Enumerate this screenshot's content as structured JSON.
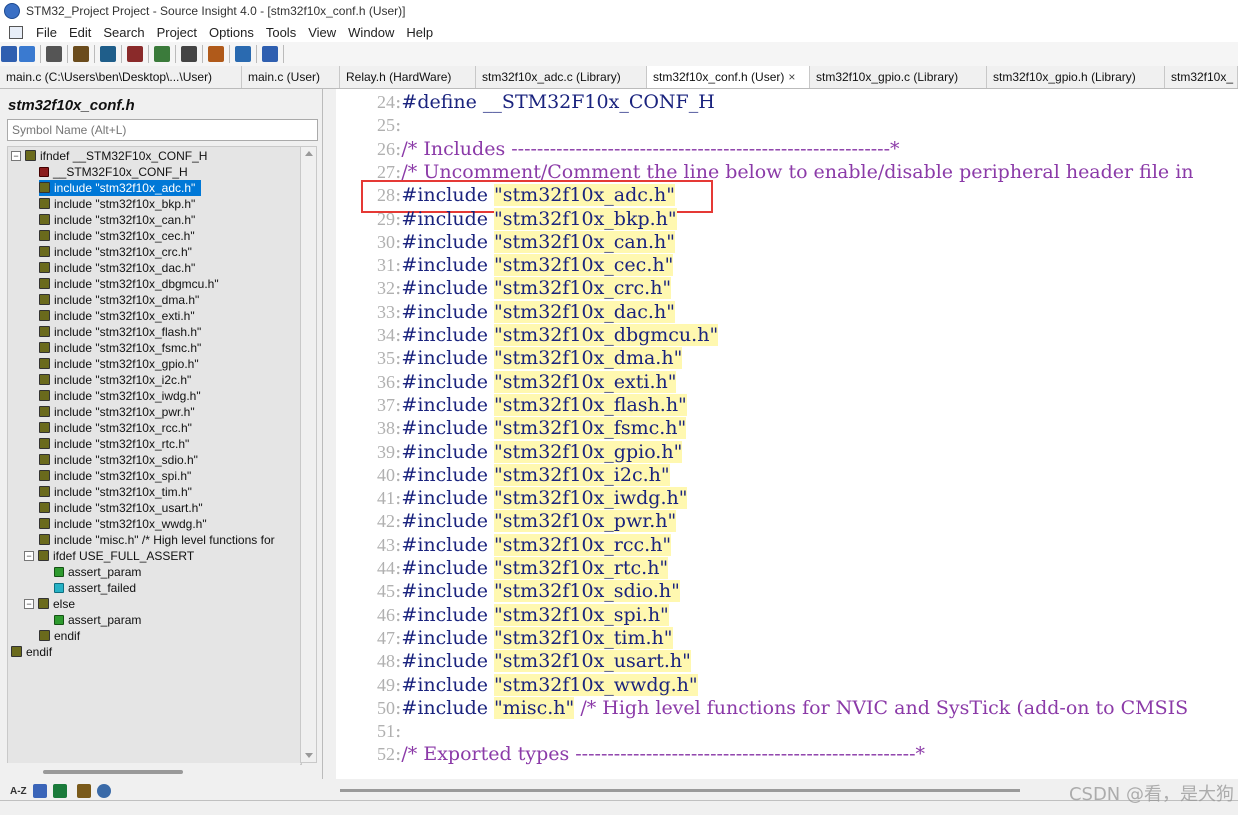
{
  "window": {
    "title": "STM32_Project Project - Source Insight 4.0 - [stm32f10x_conf.h (User)]"
  },
  "menu": [
    "File",
    "Edit",
    "Search",
    "Project",
    "Options",
    "Tools",
    "View",
    "Window",
    "Help"
  ],
  "tabs": [
    {
      "label": "main.c (C:\\Users\\ben\\Desktop\\...\\User)",
      "active": false
    },
    {
      "label": "main.c (User)",
      "active": false
    },
    {
      "label": "Relay.h (HardWare)",
      "active": false
    },
    {
      "label": "stm32f10x_adc.c (Library)",
      "active": false
    },
    {
      "label": "stm32f10x_conf.h (User)",
      "active": true,
      "close": "×"
    },
    {
      "label": "stm32f10x_gpio.c (Library)",
      "active": false
    },
    {
      "label": "stm32f10x_gpio.h (Library)",
      "active": false
    },
    {
      "label": "stm32f10x_",
      "active": false
    }
  ],
  "sidebar": {
    "title": "stm32f10x_conf.h",
    "search_placeholder": "Symbol Name (Alt+L)",
    "tree": [
      {
        "label": "ifndef __STM32F10x_CONF_H",
        "icon": "hash",
        "expander": "minus"
      },
      {
        "label": "__STM32F10x_CONF_H",
        "icon": "define"
      },
      {
        "label": "include \"stm32f10x_adc.h\"",
        "icon": "hash",
        "selected": true
      },
      {
        "label": "include \"stm32f10x_bkp.h\"",
        "icon": "hash"
      },
      {
        "label": "include \"stm32f10x_can.h\"",
        "icon": "hash"
      },
      {
        "label": "include \"stm32f10x_cec.h\"",
        "icon": "hash"
      },
      {
        "label": "include \"stm32f10x_crc.h\"",
        "icon": "hash"
      },
      {
        "label": "include \"stm32f10x_dac.h\"",
        "icon": "hash"
      },
      {
        "label": "include \"stm32f10x_dbgmcu.h\"",
        "icon": "hash"
      },
      {
        "label": "include \"stm32f10x_dma.h\"",
        "icon": "hash"
      },
      {
        "label": "include \"stm32f10x_exti.h\"",
        "icon": "hash"
      },
      {
        "label": "include \"stm32f10x_flash.h\"",
        "icon": "hash"
      },
      {
        "label": "include \"stm32f10x_fsmc.h\"",
        "icon": "hash"
      },
      {
        "label": "include \"stm32f10x_gpio.h\"",
        "icon": "hash"
      },
      {
        "label": "include \"stm32f10x_i2c.h\"",
        "icon": "hash"
      },
      {
        "label": "include \"stm32f10x_iwdg.h\"",
        "icon": "hash"
      },
      {
        "label": "include \"stm32f10x_pwr.h\"",
        "icon": "hash"
      },
      {
        "label": "include \"stm32f10x_rcc.h\"",
        "icon": "hash"
      },
      {
        "label": "include \"stm32f10x_rtc.h\"",
        "icon": "hash"
      },
      {
        "label": "include \"stm32f10x_sdio.h\"",
        "icon": "hash"
      },
      {
        "label": "include \"stm32f10x_spi.h\"",
        "icon": "hash"
      },
      {
        "label": "include \"stm32f10x_tim.h\"",
        "icon": "hash"
      },
      {
        "label": "include \"stm32f10x_usart.h\"",
        "icon": "hash"
      },
      {
        "label": "include \"stm32f10x_wwdg.h\"",
        "icon": "hash"
      },
      {
        "label": "include \"misc.h\" /* High level functions for",
        "icon": "hash"
      },
      {
        "label": "ifdef USE_FULL_ASSERT",
        "icon": "hash",
        "expander": "minus"
      },
      {
        "label": "assert_param",
        "icon": "macro"
      },
      {
        "label": "assert_failed",
        "icon": "func"
      },
      {
        "label": "else",
        "icon": "hash",
        "expander": "minus"
      },
      {
        "label": "assert_param",
        "icon": "macro"
      },
      {
        "label": "endif",
        "icon": "hash"
      },
      {
        "label": "endif",
        "icon": "hash"
      }
    ],
    "bottom_label": "A-Z"
  },
  "code": [
    {
      "n": "24",
      "parts": [
        {
          "t": "#define __STM32F10x_CONF_H",
          "c": "kw"
        }
      ]
    },
    {
      "n": "25",
      "parts": []
    },
    {
      "n": "26",
      "parts": [
        {
          "t": "/* Includes -----------------------------------------------------------*",
          "c": "cm"
        }
      ]
    },
    {
      "n": "27",
      "parts": [
        {
          "t": "/* Uncomment/Comment the line below to enable/disable peripheral header file in",
          "c": "cm"
        }
      ]
    },
    {
      "n": "28",
      "parts": [
        {
          "t": "#include ",
          "c": "kw"
        },
        {
          "t": "\"stm32f10x_adc.h\"",
          "c": "str"
        }
      ]
    },
    {
      "n": "29",
      "parts": [
        {
          "t": "#include ",
          "c": "kw"
        },
        {
          "t": "\"stm32f10x_bkp.h\"",
          "c": "str"
        }
      ]
    },
    {
      "n": "30",
      "parts": [
        {
          "t": "#include ",
          "c": "kw"
        },
        {
          "t": "\"stm32f10x_can.h\"",
          "c": "str"
        }
      ]
    },
    {
      "n": "31",
      "parts": [
        {
          "t": "#include ",
          "c": "kw"
        },
        {
          "t": "\"stm32f10x_cec.h\"",
          "c": "str"
        }
      ]
    },
    {
      "n": "32",
      "parts": [
        {
          "t": "#include ",
          "c": "kw"
        },
        {
          "t": "\"stm32f10x_crc.h\"",
          "c": "str"
        }
      ]
    },
    {
      "n": "33",
      "parts": [
        {
          "t": "#include ",
          "c": "kw"
        },
        {
          "t": "\"stm32f10x_dac.h\"",
          "c": "str"
        }
      ]
    },
    {
      "n": "34",
      "parts": [
        {
          "t": "#include ",
          "c": "kw"
        },
        {
          "t": "\"stm32f10x_dbgmcu.h\"",
          "c": "str"
        }
      ]
    },
    {
      "n": "35",
      "parts": [
        {
          "t": "#include ",
          "c": "kw"
        },
        {
          "t": "\"stm32f10x_dma.h\"",
          "c": "str"
        }
      ]
    },
    {
      "n": "36",
      "parts": [
        {
          "t": "#include ",
          "c": "kw"
        },
        {
          "t": "\"stm32f10x_exti.h\"",
          "c": "str"
        }
      ]
    },
    {
      "n": "37",
      "parts": [
        {
          "t": "#include ",
          "c": "kw"
        },
        {
          "t": "\"stm32f10x_flash.h\"",
          "c": "str"
        }
      ]
    },
    {
      "n": "38",
      "parts": [
        {
          "t": "#include ",
          "c": "kw"
        },
        {
          "t": "\"stm32f10x_fsmc.h\"",
          "c": "str"
        }
      ]
    },
    {
      "n": "39",
      "parts": [
        {
          "t": "#include ",
          "c": "kw"
        },
        {
          "t": "\"stm32f10x_gpio.h\"",
          "c": "str"
        }
      ]
    },
    {
      "n": "40",
      "parts": [
        {
          "t": "#include ",
          "c": "kw"
        },
        {
          "t": "\"stm32f10x_i2c.h\"",
          "c": "str"
        }
      ]
    },
    {
      "n": "41",
      "parts": [
        {
          "t": "#include ",
          "c": "kw"
        },
        {
          "t": "\"stm32f10x_iwdg.h\"",
          "c": "str"
        }
      ]
    },
    {
      "n": "42",
      "parts": [
        {
          "t": "#include ",
          "c": "kw"
        },
        {
          "t": "\"stm32f10x_pwr.h\"",
          "c": "str"
        }
      ]
    },
    {
      "n": "43",
      "parts": [
        {
          "t": "#include ",
          "c": "kw"
        },
        {
          "t": "\"stm32f10x_rcc.h\"",
          "c": "str"
        }
      ]
    },
    {
      "n": "44",
      "parts": [
        {
          "t": "#include ",
          "c": "kw"
        },
        {
          "t": "\"stm32f10x_rtc.h\"",
          "c": "str"
        }
      ]
    },
    {
      "n": "45",
      "parts": [
        {
          "t": "#include ",
          "c": "kw"
        },
        {
          "t": "\"stm32f10x_sdio.h\"",
          "c": "str"
        }
      ]
    },
    {
      "n": "46",
      "parts": [
        {
          "t": "#include ",
          "c": "kw"
        },
        {
          "t": "\"stm32f10x_spi.h\"",
          "c": "str"
        }
      ]
    },
    {
      "n": "47",
      "parts": [
        {
          "t": "#include ",
          "c": "kw"
        },
        {
          "t": "\"stm32f10x_tim.h\"",
          "c": "str"
        }
      ]
    },
    {
      "n": "48",
      "parts": [
        {
          "t": "#include ",
          "c": "kw"
        },
        {
          "t": "\"stm32f10x_usart.h\"",
          "c": "str"
        }
      ]
    },
    {
      "n": "49",
      "parts": [
        {
          "t": "#include ",
          "c": "kw"
        },
        {
          "t": "\"stm32f10x_wwdg.h\"",
          "c": "str"
        }
      ]
    },
    {
      "n": "50",
      "parts": [
        {
          "t": "#include ",
          "c": "kw"
        },
        {
          "t": "\"misc.h\"",
          "c": "str"
        },
        {
          "t": " /* High level functions for NVIC and SysTick (add-on to CMSIS",
          "c": "cm"
        }
      ]
    },
    {
      "n": "51",
      "parts": []
    },
    {
      "n": "52",
      "parts": [
        {
          "t": "/* Exported types -----------------------------------------------------*",
          "c": "cm"
        }
      ]
    }
  ],
  "watermark": "CSDN @看，是大狗",
  "colors": {
    "selection": "#0078d7",
    "highlight_box": "#e53935",
    "string_bg": "#fff8b0",
    "keyword": "#1a237e",
    "comment": "#8b3aa8"
  }
}
